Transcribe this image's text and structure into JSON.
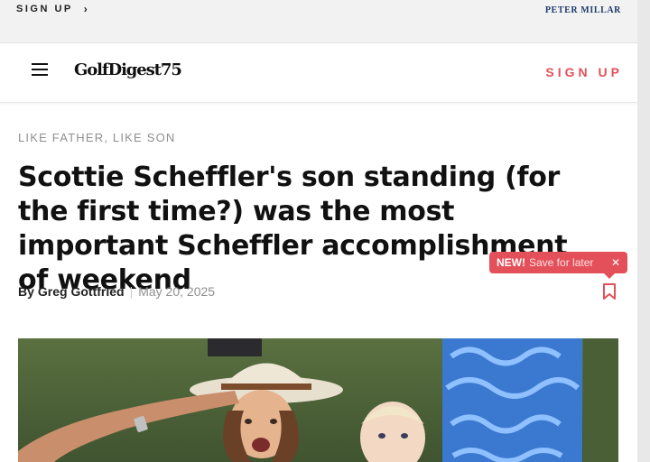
{
  "promo_bar": {
    "signup_label": "SIGN UP",
    "chevron_icon": "chevron-right-icon",
    "sponsor_logo_text": "PETER MILLAR"
  },
  "nav": {
    "menu_icon": "hamburger-menu-icon",
    "logo_text": "GolfDigest75",
    "signup_label": "SIGN UP",
    "accent_color": "#e4505a"
  },
  "article": {
    "kicker": "LIKE FATHER, LIKE SON",
    "headline": "Scottie Scheffler's son standing (for the first time?) was the most important Scheffler accomplishment of weekend",
    "byline_prefix": "By",
    "author": "Greg Gottfried",
    "separator": "|",
    "date": "May 20, 2025",
    "bookmark_icon": "bookmark-icon"
  },
  "tooltip": {
    "badge": "NEW!",
    "message": "Save for later",
    "close_icon": "close-icon",
    "close_glyph": "✕"
  },
  "hero_image": {
    "alt": "Scheffler family photo"
  }
}
